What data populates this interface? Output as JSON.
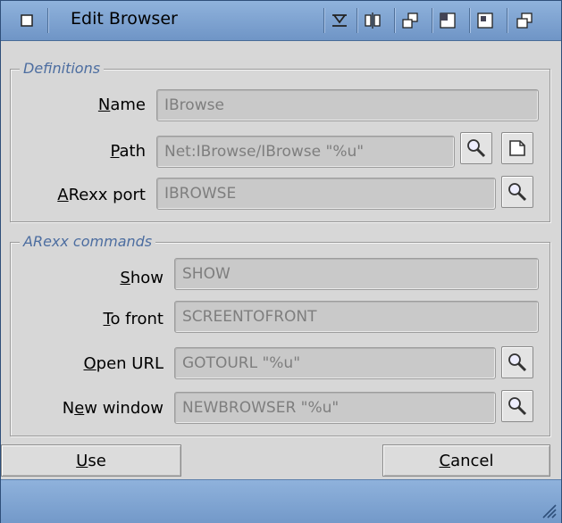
{
  "window": {
    "title": "Edit Browser"
  },
  "definitions": {
    "title": "Definitions",
    "name": {
      "label_pre": "",
      "label_key": "N",
      "label_post": "ame",
      "value": "IBrowse"
    },
    "path": {
      "label_pre": "",
      "label_key": "P",
      "label_post": "ath",
      "value": "Net:IBrowse/IBrowse \"%u\""
    },
    "arexx_port": {
      "label_pre": "",
      "label_key": "A",
      "label_post": "Rexx port",
      "value": "IBROWSE"
    }
  },
  "commands": {
    "title": "ARexx commands",
    "show": {
      "label_pre": "",
      "label_key": "S",
      "label_post": "how",
      "value": "SHOW"
    },
    "to_front": {
      "label_pre": "",
      "label_key": "T",
      "label_post": "o front",
      "value": "SCREENTOFRONT"
    },
    "open_url": {
      "label_pre": "",
      "label_key": "O",
      "label_post": "pen URL",
      "value": "GOTOURL \"%u\""
    },
    "new_window": {
      "label_pre": "N",
      "label_key": "e",
      "label_post": "w window",
      "value": "NEWBROWSER \"%u\""
    }
  },
  "buttons": {
    "use": {
      "label_pre": "",
      "label_key": "U",
      "label_post": "se"
    },
    "cancel": {
      "label_pre": "",
      "label_key": "C",
      "label_post": "ancel"
    }
  },
  "icons": {
    "close": "close-icon",
    "iconify": "iconify-icon",
    "jump": "jump-icon",
    "snapshot": "snapshot-icon",
    "zoom": "zoom-icon",
    "depth": "depth-icon",
    "search": "magnifier-icon",
    "file": "file-icon",
    "resize": "resize-grip-icon"
  },
  "colors": {
    "titlebar": "#7d9ec8",
    "group_title": "#4c6da0",
    "window_bg": "#d7d7d7",
    "field_bg": "#c9c9c9"
  }
}
